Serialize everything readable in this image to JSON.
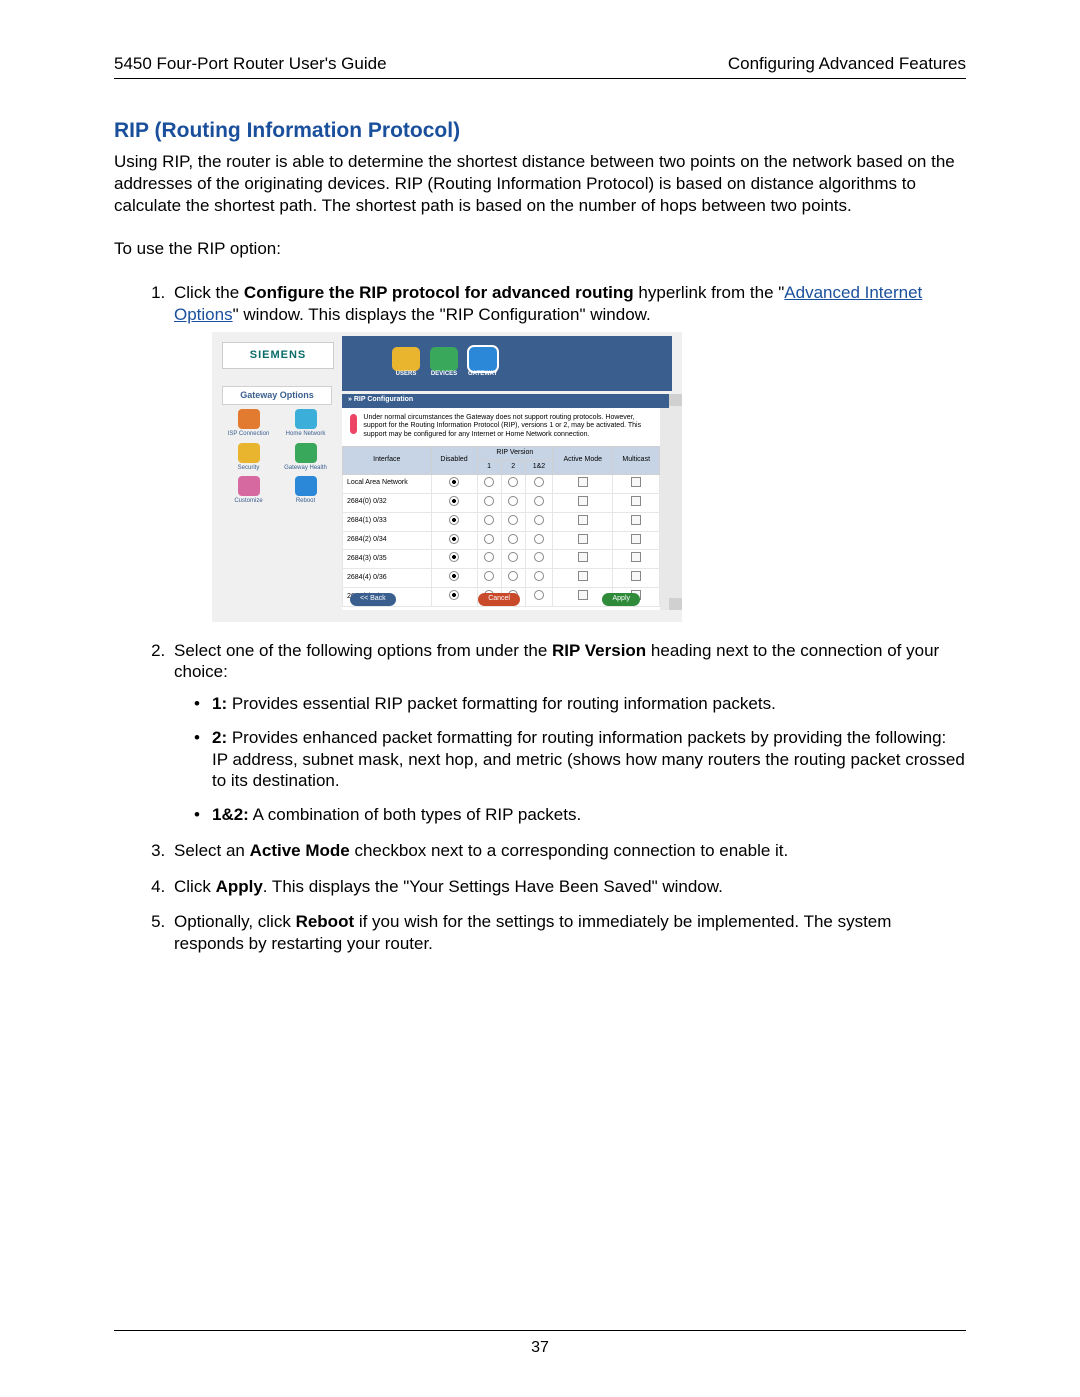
{
  "header": {
    "left": "5450 Four-Port Router User's Guide",
    "right": "Configuring Advanced Features"
  },
  "title": "RIP (Routing Information Protocol)",
  "intro": "Using RIP, the router is able to determine the shortest distance between two points on the network based on the addresses of the originating devices. RIP (Routing Information Protocol) is based on distance algorithms to calculate the shortest path. The shortest path is based on the number of hops between two points.",
  "lead": "To use the RIP option:",
  "step1": {
    "a": "Click the ",
    "b": "Configure the RIP protocol for advanced routing",
    "c": " hyperlink from the \"",
    "link": "Advanced Internet Options",
    "d": "\" window. This displays the \"RIP Configuration\" window."
  },
  "screenshot": {
    "logo": "SIEMENS",
    "sidebar_title": "Gateway Options",
    "sidebar_items": [
      {
        "label": "ISP Connection",
        "color": "#e27b2f"
      },
      {
        "label": "Home Network",
        "color": "#3bafda"
      },
      {
        "label": "Security",
        "color": "#e9b52f"
      },
      {
        "label": "Gateway Health",
        "color": "#3aa85a"
      },
      {
        "label": "Customize",
        "color": "#d66aa0"
      },
      {
        "label": "Reboot",
        "color": "#2b88d8"
      }
    ],
    "topnav": [
      {
        "label": "USERS",
        "color": "#e9b52f"
      },
      {
        "label": "DEVICES",
        "color": "#3aa85a"
      },
      {
        "label": "GATEWAY",
        "color": "#2b88d8",
        "selected": true
      }
    ],
    "band": "» RIP Configuration",
    "desc": "Under normal circumstances the Gateway does not support routing protocols. However, support for the Routing Information Protocol (RIP), versions 1 or 2, may be activated. This support may be configured for any Internet or Home Network connection.",
    "columns": {
      "iface": "Interface",
      "disabled": "Disabled",
      "rip": "RIP Version",
      "v1": "1",
      "v2": "2",
      "v12": "1&2",
      "active": "Active Mode",
      "multi": "Multicast"
    },
    "rows": [
      {
        "iface": "Local Area Network"
      },
      {
        "iface": "2684(0) 0/32"
      },
      {
        "iface": "2684(1) 0/33"
      },
      {
        "iface": "2684(2) 0/34"
      },
      {
        "iface": "2684(3) 0/35"
      },
      {
        "iface": "2684(4) 0/36"
      },
      {
        "iface": "2684(5) 0/37"
      }
    ],
    "buttons": {
      "back": "<< Back",
      "cancel": "Cancel",
      "apply": "Apply"
    }
  },
  "step2": {
    "a": "Select one of the following options from under the ",
    "b": "RIP Version",
    "c": " heading next to the connection of your choice:",
    "opt1a": "1:",
    "opt1b": " Provides essential RIP packet formatting for routing information packets.",
    "opt2a": "2:",
    "opt2b": " Provides enhanced packet formatting for routing information packets by providing the following: IP address, subnet mask, next hop, and metric (shows how many routers the routing packet crossed to its destination.",
    "opt3a": "1&2:",
    "opt3b": " A combination of both types of RIP packets."
  },
  "step3": {
    "a": "Select an ",
    "b": "Active Mode",
    "c": " checkbox next to a corresponding connection to enable it."
  },
  "step4": {
    "a": "Click ",
    "b": "Apply",
    "c": ". This displays the \"Your Settings Have Been Saved\" window."
  },
  "step5": {
    "a": "Optionally, click ",
    "b": "Reboot",
    "c": " if you wish for the settings to immediately be implemented. The system responds by restarting your router."
  },
  "page_number": "37"
}
